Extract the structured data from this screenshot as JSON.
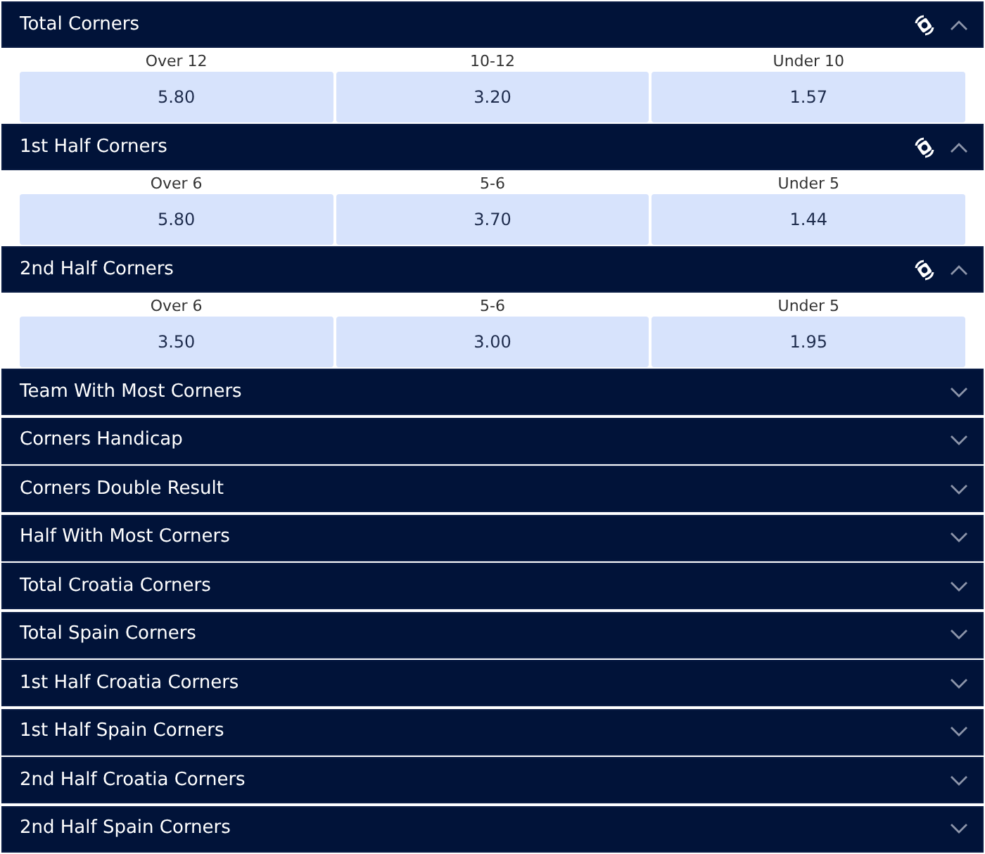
{
  "markets": [
    {
      "title": "Total Corners",
      "expanded": true,
      "icon_shown": true,
      "outcomes": [
        {
          "label": "Over 12",
          "odds": "5.80"
        },
        {
          "label": "10-12",
          "odds": "3.20"
        },
        {
          "label": "Under 10",
          "odds": "1.57"
        }
      ]
    },
    {
      "title": "1st Half Corners",
      "expanded": true,
      "icon_shown": true,
      "outcomes": [
        {
          "label": "Over 6",
          "odds": "5.80"
        },
        {
          "label": "5-6",
          "odds": "3.70"
        },
        {
          "label": "Under 5",
          "odds": "1.44"
        }
      ]
    },
    {
      "title": "2nd Half Corners",
      "expanded": true,
      "icon_shown": true,
      "outcomes": [
        {
          "label": "Over 6",
          "odds": "3.50"
        },
        {
          "label": "5-6",
          "odds": "3.00"
        },
        {
          "label": "Under 5",
          "odds": "1.95"
        }
      ]
    },
    {
      "title": "Team With Most Corners",
      "expanded": false,
      "icon_shown": false
    },
    {
      "title": "Corners Handicap",
      "expanded": false,
      "icon_shown": false
    },
    {
      "title": "Corners Double Result",
      "expanded": false,
      "icon_shown": false
    },
    {
      "title": "Half With Most Corners",
      "expanded": false,
      "icon_shown": false
    },
    {
      "title": "Total Croatia Corners",
      "expanded": false,
      "icon_shown": false
    },
    {
      "title": "Total Spain Corners",
      "expanded": false,
      "icon_shown": false
    },
    {
      "title": "1st Half Croatia Corners",
      "expanded": false,
      "icon_shown": false
    },
    {
      "title": "1st Half Spain Corners",
      "expanded": false,
      "icon_shown": false
    },
    {
      "title": "2nd Half Croatia Corners",
      "expanded": false,
      "icon_shown": false
    },
    {
      "title": "2nd Half Spain Corners",
      "expanded": false,
      "icon_shown": false
    }
  ]
}
